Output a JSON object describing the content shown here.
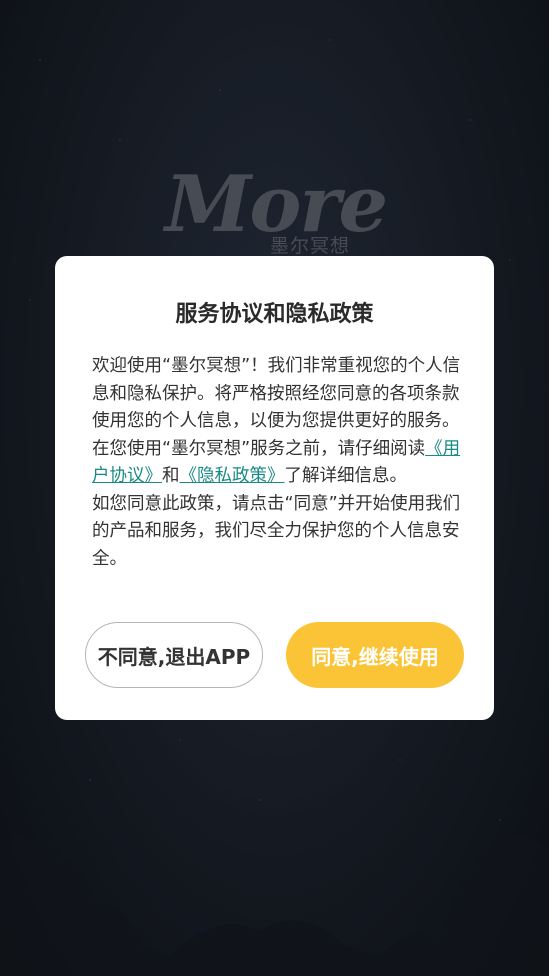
{
  "background": {
    "logo_main": "More",
    "logo_sub": "墨尔冥想"
  },
  "dialog": {
    "title": "服务协议和隐私政策",
    "para1_part1": "欢迎使用“墨尔冥想”！我们非常重视您的个人信息和隐私保护。将严格按照经您同意的各项条款使用您的个人信息，以便为您提供更好的服务。在您使用“墨尔冥想”服务之前，请仔细阅读",
    "user_agreement_link": "《用户协议》",
    "para1_and": "和",
    "privacy_policy_link": "《隐私政策》",
    "para1_part2": "了解详细信息。",
    "para2": "如您同意此政策，请点击“同意”并开始使用我们的产品和服务，我们尽全力保护您的个人信息安全。",
    "disagree_button": "不同意,退出APP",
    "agree_button": "同意,继续使用"
  },
  "colors": {
    "accent": "#fbc436",
    "link": "#1a8a86",
    "background": "#1c222d"
  }
}
